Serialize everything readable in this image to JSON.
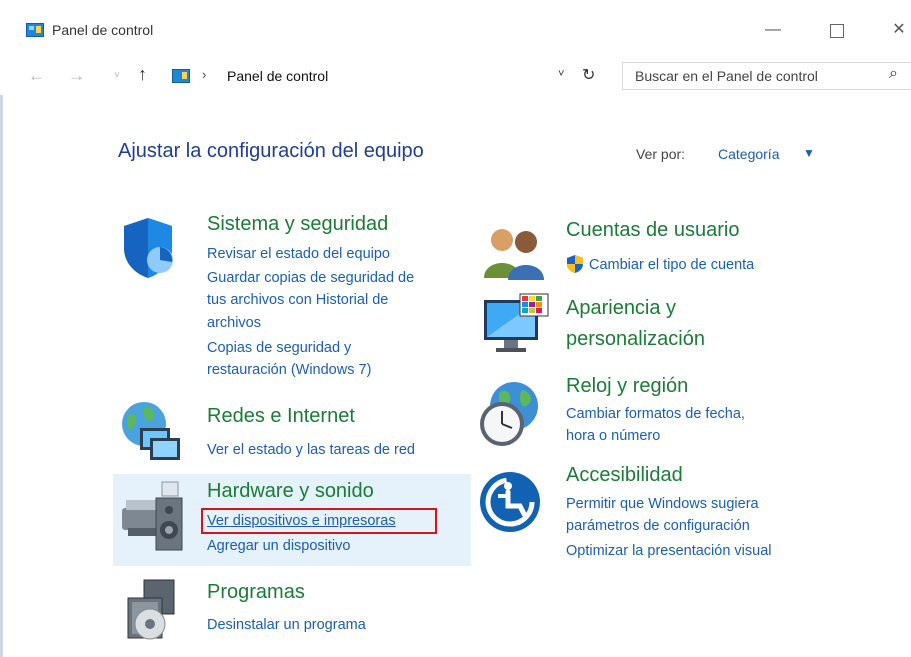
{
  "window": {
    "title": "Panel de control",
    "minimize_glyph": "—",
    "close_glyph": "✕"
  },
  "navigation": {
    "back_glyph": "←",
    "forward_glyph": "→",
    "recent_glyph": "˅",
    "up_glyph": "↑",
    "breadcrumb_sep": "›",
    "address": "Panel de control",
    "dropdown_glyph": "˅",
    "refresh_glyph": "↻",
    "search_placeholder": "Buscar en el Panel de control",
    "search_glyph": "⌕"
  },
  "main": {
    "heading": "Ajustar la configuración del equipo",
    "view_by_label": "Ver por:",
    "view_by_value": "Categoría",
    "view_by_caret": "▼"
  },
  "categories": {
    "system": {
      "title": "Sistema y seguridad",
      "links": [
        "Revisar el estado del equipo",
        "Guardar copias de seguridad de",
        "tus archivos con Historial de",
        "archivos",
        "Copias de seguridad y",
        "restauración (Windows 7)"
      ],
      "icon": "shield-icon"
    },
    "network": {
      "title": "Redes e Internet",
      "links": [
        "Ver el estado y las tareas de red"
      ],
      "icon": "network-globe-icon"
    },
    "hardware": {
      "title": "Hardware y sonido",
      "links": [
        "Ver dispositivos e impresoras",
        "Agregar un dispositivo"
      ],
      "icon": "printer-speaker-icon"
    },
    "programs": {
      "title": "Programas",
      "links": [
        "Desinstalar un programa"
      ],
      "icon": "programs-disc-icon"
    },
    "users": {
      "title": "Cuentas de usuario",
      "links": [
        "Cambiar el tipo de cuenta"
      ],
      "icon": "users-icon"
    },
    "appearance": {
      "title_line1": "Apariencia y",
      "title_line2": "personalización",
      "icon": "monitor-palette-icon"
    },
    "clock": {
      "title": "Reloj y región",
      "links": [
        "Cambiar formatos de fecha,",
        "hora o número"
      ],
      "icon": "clock-globe-icon"
    },
    "access": {
      "title": "Accesibilidad",
      "links": [
        "Permitir que Windows sugiera",
        "parámetros de configuración",
        "Optimizar la presentación visual"
      ],
      "icon": "accessibility-icon"
    }
  },
  "colors": {
    "link": "#1a5fb4",
    "category_title": "#1b7d35",
    "heading": "#1e3e9a",
    "selected_bg": "#e5f1fb",
    "highlight_box": "#d7141a"
  }
}
